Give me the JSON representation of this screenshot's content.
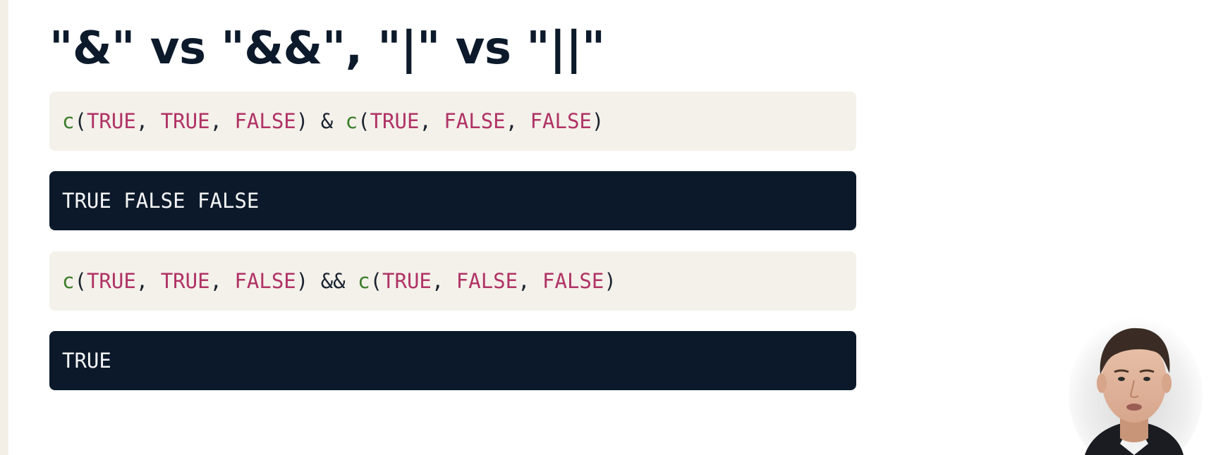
{
  "title": "\"&\" vs \"&&\", \"|\" vs \"||\"",
  "code_blocks": [
    {
      "tokens": [
        {
          "t": "c",
          "k": "fn"
        },
        {
          "t": "(",
          "k": "punc"
        },
        {
          "t": "TRUE",
          "k": "const"
        },
        {
          "t": ", ",
          "k": "punc"
        },
        {
          "t": "TRUE",
          "k": "const"
        },
        {
          "t": ", ",
          "k": "punc"
        },
        {
          "t": "FALSE",
          "k": "const"
        },
        {
          "t": ")",
          "k": "punc"
        },
        {
          "t": " & ",
          "k": "op"
        },
        {
          "t": "c",
          "k": "fn"
        },
        {
          "t": "(",
          "k": "punc"
        },
        {
          "t": "TRUE",
          "k": "const"
        },
        {
          "t": ", ",
          "k": "punc"
        },
        {
          "t": "FALSE",
          "k": "const"
        },
        {
          "t": ", ",
          "k": "punc"
        },
        {
          "t": "FALSE",
          "k": "const"
        },
        {
          "t": ")",
          "k": "punc"
        }
      ],
      "output": "TRUE FALSE FALSE"
    },
    {
      "tokens": [
        {
          "t": "c",
          "k": "fn"
        },
        {
          "t": "(",
          "k": "punc"
        },
        {
          "t": "TRUE",
          "k": "const"
        },
        {
          "t": ", ",
          "k": "punc"
        },
        {
          "t": "TRUE",
          "k": "const"
        },
        {
          "t": ", ",
          "k": "punc"
        },
        {
          "t": "FALSE",
          "k": "const"
        },
        {
          "t": ")",
          "k": "punc"
        },
        {
          "t": " && ",
          "k": "op"
        },
        {
          "t": "c",
          "k": "fn"
        },
        {
          "t": "(",
          "k": "punc"
        },
        {
          "t": "TRUE",
          "k": "const"
        },
        {
          "t": ", ",
          "k": "punc"
        },
        {
          "t": "FALSE",
          "k": "const"
        },
        {
          "t": ", ",
          "k": "punc"
        },
        {
          "t": "FALSE",
          "k": "const"
        },
        {
          "t": ")",
          "k": "punc"
        }
      ],
      "output": "TRUE"
    }
  ],
  "colors": {
    "title": "#0c1a2b",
    "code_background": "#f4f1ea",
    "output_background": "#0b192b",
    "function": "#3a7d2a",
    "constant": "#b03366"
  },
  "webcam_icon": "presenter-video-icon"
}
